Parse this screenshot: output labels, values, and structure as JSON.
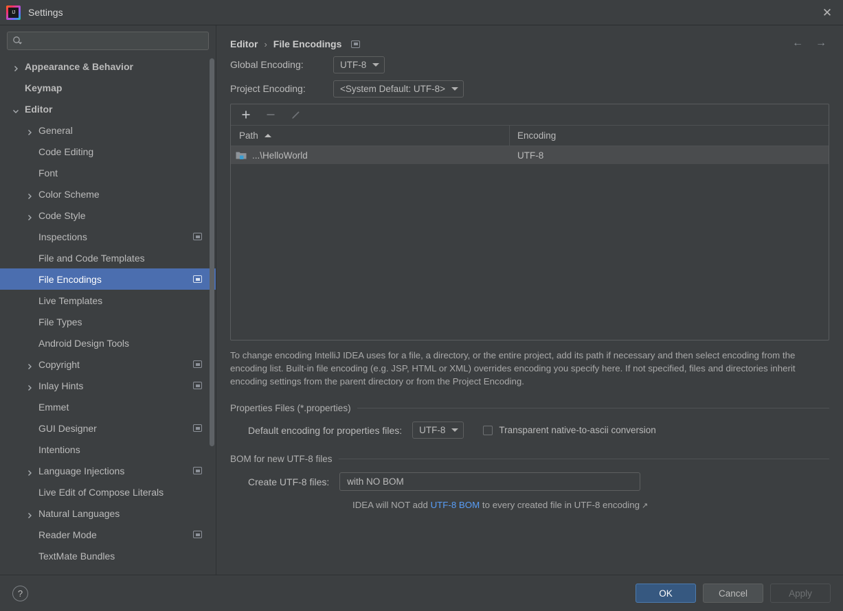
{
  "window": {
    "title": "Settings",
    "logo_text": "IJ",
    "close_label": "✕"
  },
  "search": {
    "placeholder": "",
    "value": "",
    "icon": "search-icon"
  },
  "sidebar": {
    "items": [
      {
        "label": "Appearance & Behavior",
        "level": 0,
        "expandable": true,
        "expanded": false,
        "selected": false,
        "project_icon": false
      },
      {
        "label": "Keymap",
        "level": 0,
        "expandable": false,
        "expanded": false,
        "selected": false,
        "project_icon": false
      },
      {
        "label": "Editor",
        "level": 0,
        "expandable": true,
        "expanded": true,
        "selected": false,
        "project_icon": false
      },
      {
        "label": "General",
        "level": 1,
        "expandable": true,
        "expanded": false,
        "selected": false,
        "project_icon": false
      },
      {
        "label": "Code Editing",
        "level": 1,
        "expandable": false,
        "expanded": false,
        "selected": false,
        "project_icon": false
      },
      {
        "label": "Font",
        "level": 1,
        "expandable": false,
        "expanded": false,
        "selected": false,
        "project_icon": false
      },
      {
        "label": "Color Scheme",
        "level": 1,
        "expandable": true,
        "expanded": false,
        "selected": false,
        "project_icon": false
      },
      {
        "label": "Code Style",
        "level": 1,
        "expandable": true,
        "expanded": false,
        "selected": false,
        "project_icon": false
      },
      {
        "label": "Inspections",
        "level": 1,
        "expandable": false,
        "expanded": false,
        "selected": false,
        "project_icon": true
      },
      {
        "label": "File and Code Templates",
        "level": 1,
        "expandable": false,
        "expanded": false,
        "selected": false,
        "project_icon": false
      },
      {
        "label": "File Encodings",
        "level": 1,
        "expandable": false,
        "expanded": false,
        "selected": true,
        "project_icon": true
      },
      {
        "label": "Live Templates",
        "level": 1,
        "expandable": false,
        "expanded": false,
        "selected": false,
        "project_icon": false
      },
      {
        "label": "File Types",
        "level": 1,
        "expandable": false,
        "expanded": false,
        "selected": false,
        "project_icon": false
      },
      {
        "label": "Android Design Tools",
        "level": 1,
        "expandable": false,
        "expanded": false,
        "selected": false,
        "project_icon": false
      },
      {
        "label": "Copyright",
        "level": 1,
        "expandable": true,
        "expanded": false,
        "selected": false,
        "project_icon": true
      },
      {
        "label": "Inlay Hints",
        "level": 1,
        "expandable": true,
        "expanded": false,
        "selected": false,
        "project_icon": true
      },
      {
        "label": "Emmet",
        "level": 1,
        "expandable": false,
        "expanded": false,
        "selected": false,
        "project_icon": false
      },
      {
        "label": "GUI Designer",
        "level": 1,
        "expandable": false,
        "expanded": false,
        "selected": false,
        "project_icon": true
      },
      {
        "label": "Intentions",
        "level": 1,
        "expandable": false,
        "expanded": false,
        "selected": false,
        "project_icon": false
      },
      {
        "label": "Language Injections",
        "level": 1,
        "expandable": true,
        "expanded": false,
        "selected": false,
        "project_icon": true
      },
      {
        "label": "Live Edit of Compose Literals",
        "level": 1,
        "expandable": false,
        "expanded": false,
        "selected": false,
        "project_icon": false
      },
      {
        "label": "Natural Languages",
        "level": 1,
        "expandable": true,
        "expanded": false,
        "selected": false,
        "project_icon": false
      },
      {
        "label": "Reader Mode",
        "level": 1,
        "expandable": false,
        "expanded": false,
        "selected": false,
        "project_icon": true
      },
      {
        "label": "TextMate Bundles",
        "level": 1,
        "expandable": false,
        "expanded": false,
        "selected": false,
        "project_icon": false
      }
    ]
  },
  "breadcrumb": {
    "parent": "Editor",
    "separator": "›",
    "current": "File Encodings"
  },
  "nav": {
    "back": "←",
    "forward": "→"
  },
  "encodings": {
    "global_label": "Global Encoding:",
    "global_value": "UTF-8",
    "project_label": "Project Encoding:",
    "project_value": "<System Default: UTF-8>"
  },
  "table": {
    "toolbar": {
      "add": "+",
      "remove": "−",
      "edit": "pencil-icon"
    },
    "columns": [
      "Path",
      "Encoding"
    ],
    "sort_column": "Path",
    "sort_direction": "asc",
    "rows": [
      {
        "path": "...\\HelloWorld",
        "encoding": "UTF-8",
        "selected": true
      }
    ]
  },
  "description": "To change encoding IntelliJ IDEA uses for a file, a directory, or the entire project, add its path if necessary and then select encoding from the encoding list. Built-in file encoding (e.g. JSP, HTML or XML) overrides encoding you specify here. If not specified, files and directories inherit encoding settings from the parent directory or from the Project Encoding.",
  "properties_section": {
    "title": "Properties Files (*.properties)",
    "default_encoding_label": "Default encoding for properties files:",
    "default_encoding_value": "UTF-8",
    "transparent_label": "Transparent native-to-ascii conversion",
    "transparent_checked": false
  },
  "bom_section": {
    "title": "BOM for new UTF-8 files",
    "create_label": "Create UTF-8 files:",
    "create_value": "with NO BOM",
    "hint_prefix": "IDEA will NOT add ",
    "hint_link": "UTF-8 BOM",
    "hint_suffix": " to every created file in UTF-8 encoding",
    "hint_external_icon": "↗"
  },
  "footer": {
    "help": "?",
    "ok": "OK",
    "cancel": "Cancel",
    "apply": "Apply",
    "apply_enabled": false
  },
  "colors": {
    "window_bg": "#3C3F41",
    "selection_blue": "#4B6EAF",
    "primary_button": "#365880",
    "link_blue": "#589DF6",
    "text": "#BBBBBB"
  }
}
